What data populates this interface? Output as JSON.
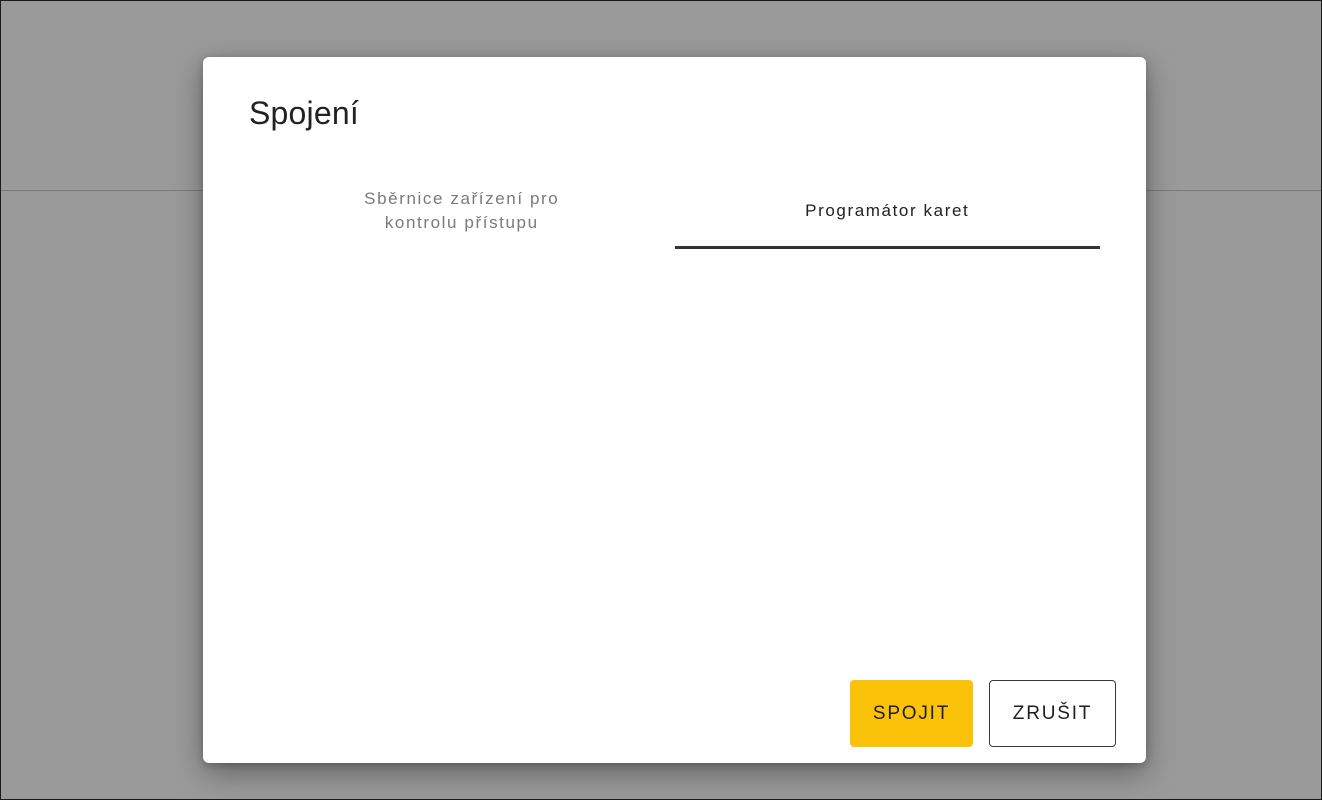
{
  "dialog": {
    "title": "Spojení",
    "tabs": [
      {
        "label": "Sběrnice zařízení pro\nkontrolu přístupu",
        "active": false
      },
      {
        "label": "Programátor karet",
        "active": true
      }
    ],
    "buttons": {
      "connect_label": "SPOJIT",
      "cancel_label": "ZRUŠIT"
    }
  },
  "colors": {
    "overlay": "#9a9a9a",
    "primary_button": "#fbc20a",
    "active_tab_indicator": "#333333",
    "inactive_tab_text": "#7a7a7a"
  }
}
